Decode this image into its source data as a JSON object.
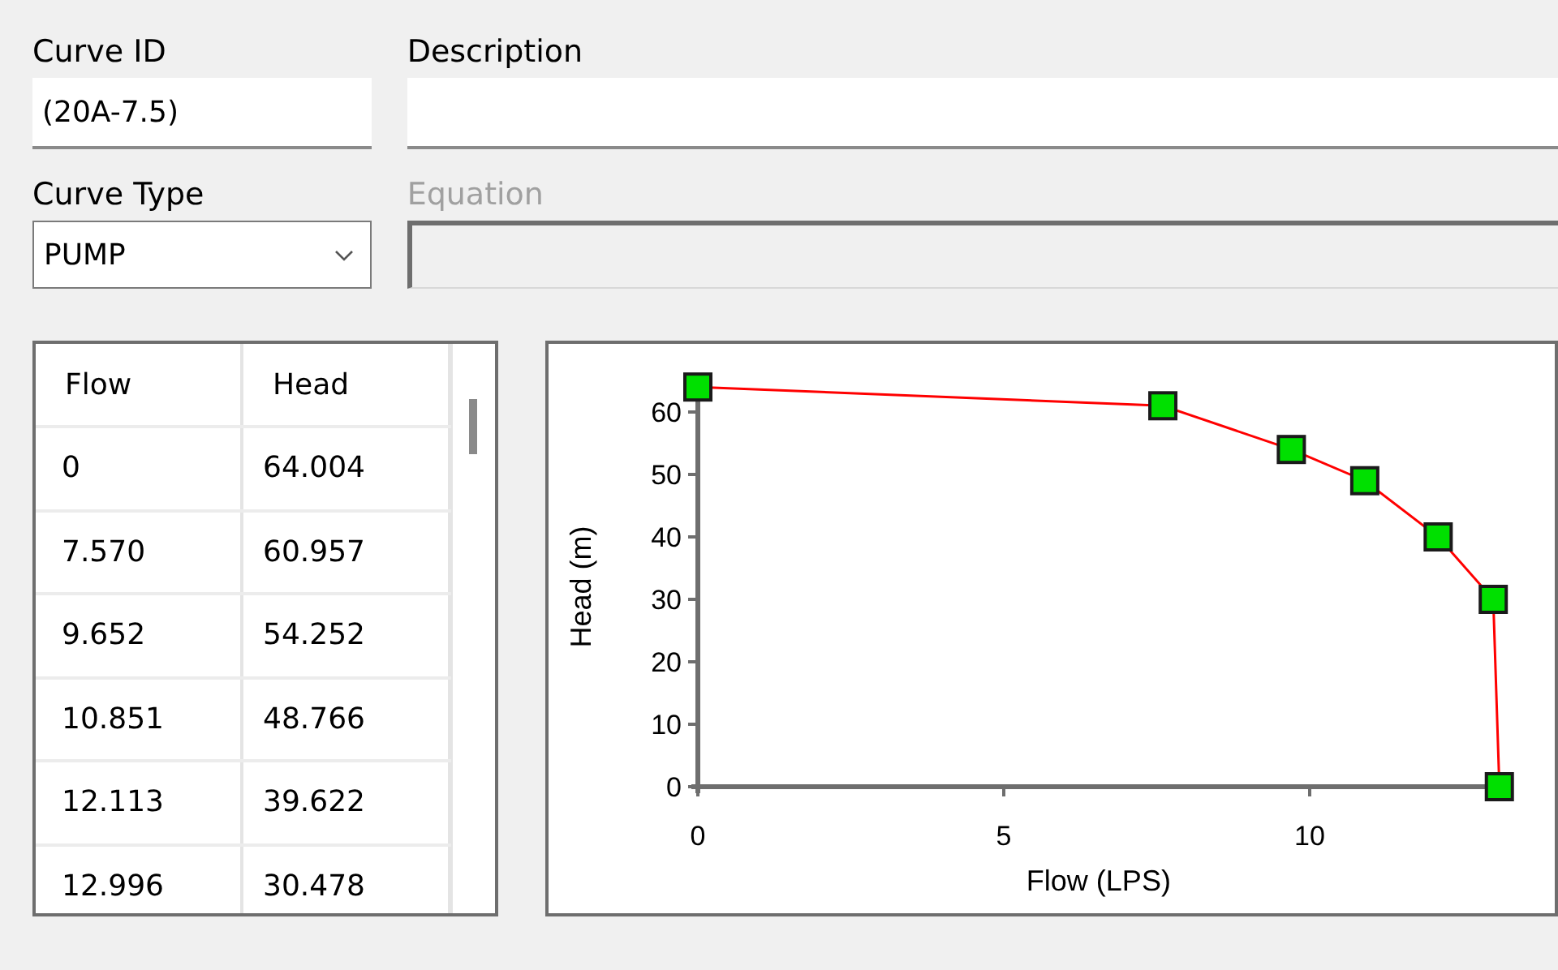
{
  "curve_id": {
    "label": "Curve ID",
    "value": "(20A-7.5)"
  },
  "description": {
    "label": "Description"
  },
  "curve_type": {
    "label": "Curve Type",
    "value": "PUMP"
  },
  "equation": {
    "label": "Equation",
    "disabled": true
  },
  "table": {
    "columns": [
      "Flow",
      "Head"
    ],
    "rows": [
      [
        "0",
        "64.004"
      ],
      [
        "7.570",
        "60.957"
      ],
      [
        "9.652",
        "54.252"
      ],
      [
        "10.851",
        "48.766"
      ],
      [
        "12.113",
        "39.622"
      ],
      [
        "12.996",
        "30.478"
      ]
    ]
  },
  "chart": {
    "chart_data": {
      "type": "line",
      "xlabel": "Flow (LPS)",
      "ylabel": "Head (m)",
      "x": [
        0,
        7.6,
        9.7,
        10.9,
        12.1,
        13,
        13.1
      ],
      "series": [
        {
          "color": "#ff0000",
          "marker": "square",
          "values": [
            64,
            61,
            54,
            49,
            40,
            30,
            0
          ]
        }
      ],
      "xlim": [
        0,
        13.1
      ],
      "ylim": [
        0,
        64
      ],
      "xticks": [
        0,
        5,
        10
      ],
      "yticks": [
        0,
        10,
        20,
        30,
        40,
        50,
        60
      ]
    }
  }
}
